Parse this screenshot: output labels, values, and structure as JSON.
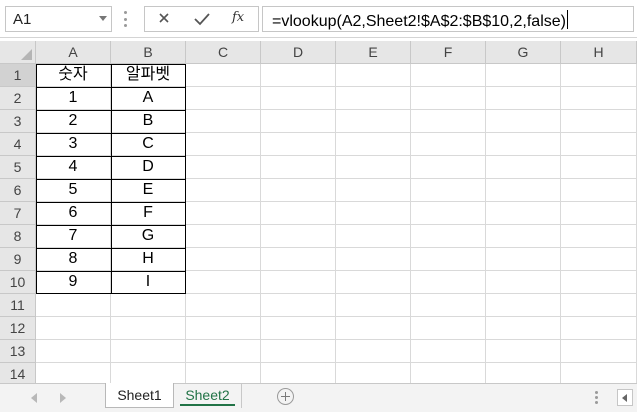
{
  "name_box": {
    "value": "A1"
  },
  "formula_bar": {
    "cancel_icon": "close-icon",
    "enter_icon": "check-icon",
    "fx_label": "fx",
    "formula": "=vlookup(A2,Sheet2!$A$2:$B$10,2,false)"
  },
  "columns": [
    "A",
    "B",
    "C",
    "D",
    "E",
    "F",
    "G",
    "H"
  ],
  "rows": [
    "1",
    "2",
    "3",
    "4",
    "5",
    "6",
    "7",
    "8",
    "9",
    "10",
    "11",
    "12",
    "13",
    "14"
  ],
  "table": {
    "headers": [
      "숫자",
      "알파벳"
    ],
    "data": [
      [
        "1",
        "A"
      ],
      [
        "2",
        "B"
      ],
      [
        "3",
        "C"
      ],
      [
        "4",
        "D"
      ],
      [
        "5",
        "E"
      ],
      [
        "6",
        "F"
      ],
      [
        "7",
        "G"
      ],
      [
        "8",
        "H"
      ],
      [
        "9",
        "I"
      ]
    ]
  },
  "sheet_tabs": [
    {
      "label": "Sheet1",
      "active": false
    },
    {
      "label": "Sheet2",
      "active": true
    }
  ],
  "colors": {
    "accent_green": "#217346",
    "header_bg": "#e6e6e6",
    "grid_line": "#d9d9d9"
  }
}
